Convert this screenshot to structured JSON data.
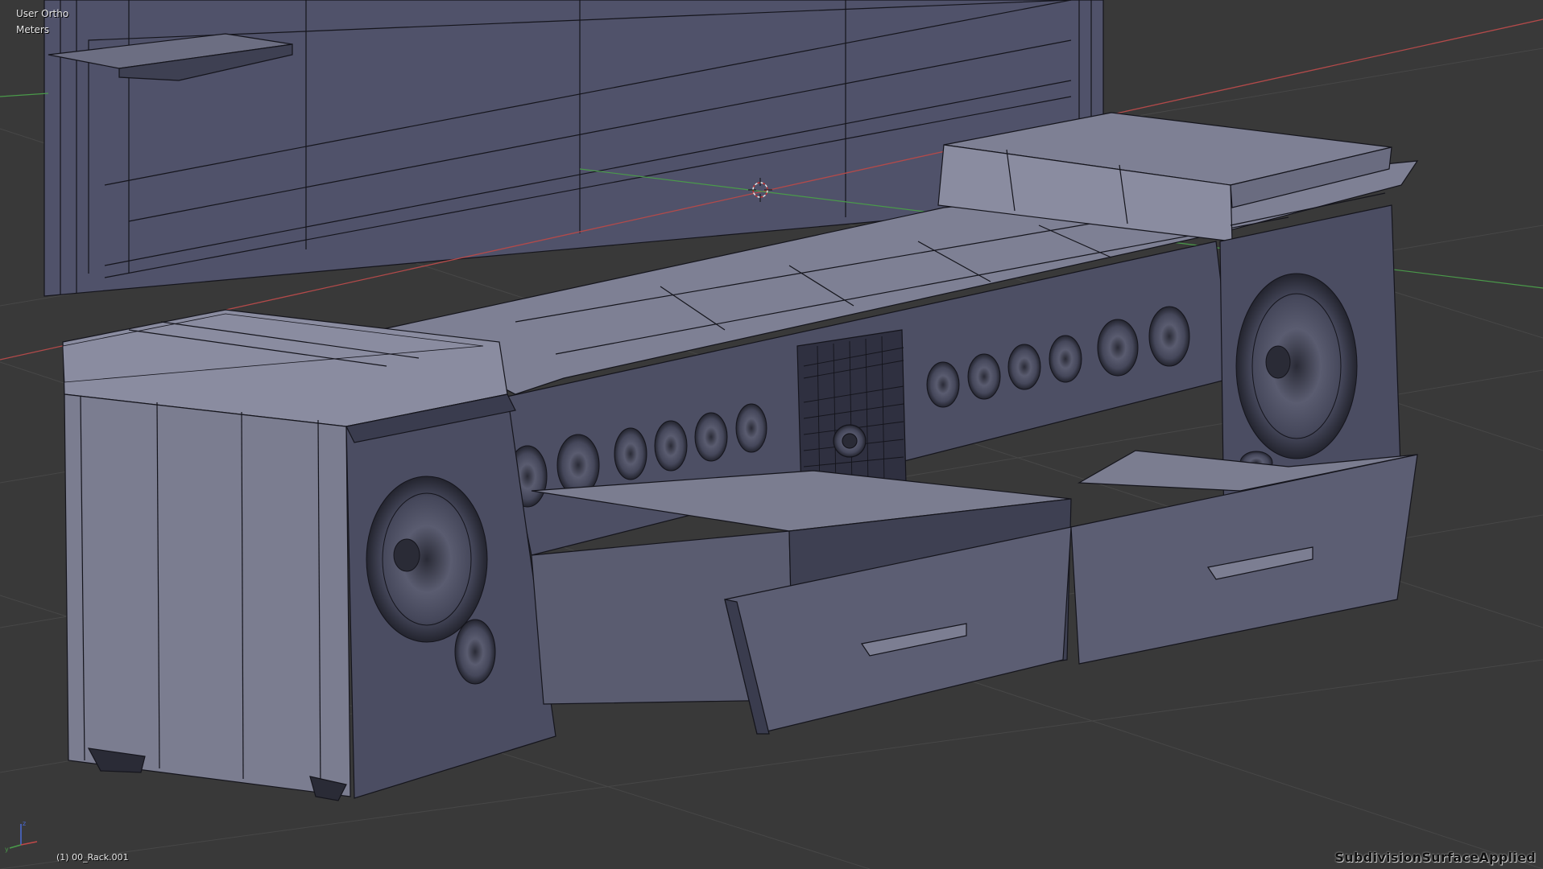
{
  "viewport": {
    "view_mode": "User Ortho",
    "units": "Meters",
    "object_info": "(1) 00_Rack.001",
    "watermark": "SubdivisionSurfaceApplied"
  },
  "colors": {
    "background": "#393939",
    "grid": "#4a4a4a",
    "mesh_fill": "#52546a",
    "mesh_light": "#6e7084",
    "mesh_dark": "#363748",
    "wire": "#15151c",
    "x_axis": "#b34a4a",
    "y_axis": "#4a9a4a",
    "z_axis": "#4a6ad6"
  },
  "icons": {
    "cursor": "3d-cursor-icon",
    "gizmo": "axis-gizmo-icon"
  },
  "speakers": {
    "left_panel_count": 6,
    "right_panel_count": 6
  }
}
